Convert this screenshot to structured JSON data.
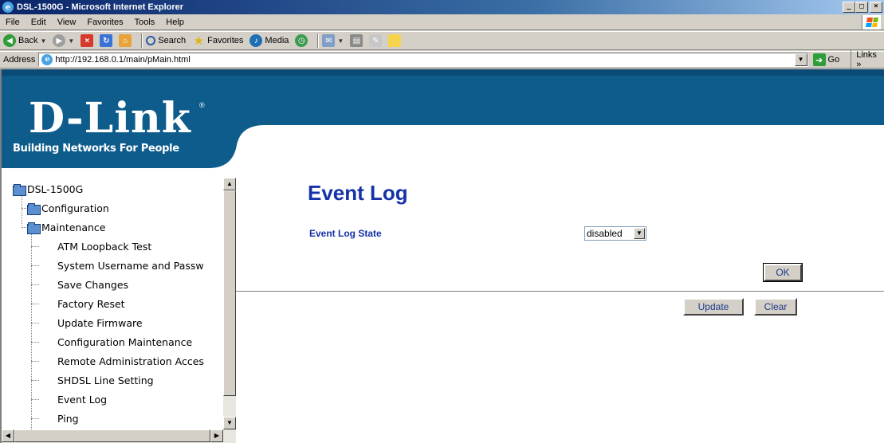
{
  "window": {
    "title": "DSL-1500G - Microsoft Internet Explorer"
  },
  "menubar": {
    "items": [
      "File",
      "Edit",
      "View",
      "Favorites",
      "Tools",
      "Help"
    ]
  },
  "toolbar": {
    "back": "Back",
    "search": "Search",
    "favorites": "Favorites",
    "media": "Media"
  },
  "address": {
    "label": "Address",
    "url": "http://192.168.0.1/main/pMain.html",
    "go": "Go",
    "links": "Links »"
  },
  "banner": {
    "logo": "D-Link",
    "reg": "®",
    "tagline": "Building Networks For People",
    "color": "#0e5c8c"
  },
  "tree": {
    "root": "DSL-1500G",
    "configuration": "Configuration",
    "maintenance": "Maintenance",
    "items": [
      "ATM Loopback Test",
      "System Username and Passw",
      "Save Changes",
      "Factory Reset",
      "Update Firmware",
      "Configuration Maintenance",
      "Remote Administration Acces",
      "SHDSL Line Setting",
      "Event Log",
      "Ping"
    ]
  },
  "main": {
    "title": "Event Log",
    "field_label": "Event Log State",
    "select_value": "disabled",
    "ok": "OK",
    "update": "Update",
    "clear": "Clear",
    "accent": "#1632a8"
  }
}
